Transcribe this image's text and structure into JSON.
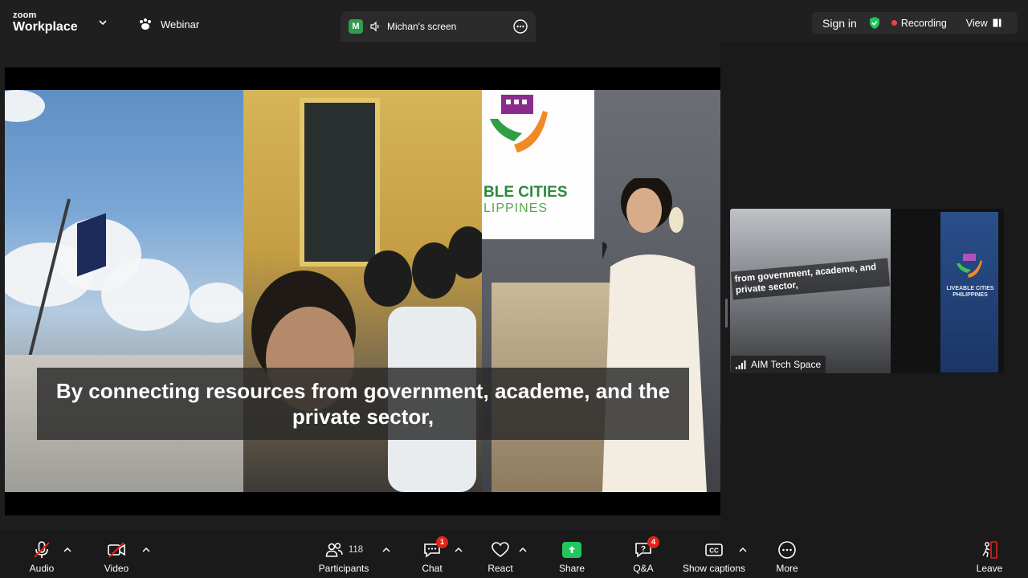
{
  "app": {
    "brand_top": "zoom",
    "brand_bottom": "Workplace"
  },
  "header": {
    "webinar_label": "Webinar",
    "share_badge": "M",
    "share_title": "Michan's screen",
    "sign_in": "Sign in",
    "recording": "Recording",
    "view": "View"
  },
  "shared_content": {
    "caption": "By connecting resources from government, academe, and the private sector,",
    "banner_line1": "BLE CITIES",
    "banner_line2": "LIPPINES"
  },
  "participant_tile": {
    "name": "AIM Tech Space",
    "screen_text": "from government, academe, and private sector,",
    "banner_text": "LIVEABLE CITIES PHILIPPINES"
  },
  "toolbar": {
    "audio": "Audio",
    "video": "Video",
    "participants": "Participants",
    "participants_count": "118",
    "chat": "Chat",
    "chat_badge": "1",
    "react": "React",
    "share": "Share",
    "qa": "Q&A",
    "qa_badge": "4",
    "captions": "Show captions",
    "more": "More",
    "leave": "Leave"
  },
  "colors": {
    "accent_green": "#22c55e",
    "recording_red": "#f04040",
    "badge_red": "#e2231a",
    "bar_bg": "#1f1f1f"
  }
}
